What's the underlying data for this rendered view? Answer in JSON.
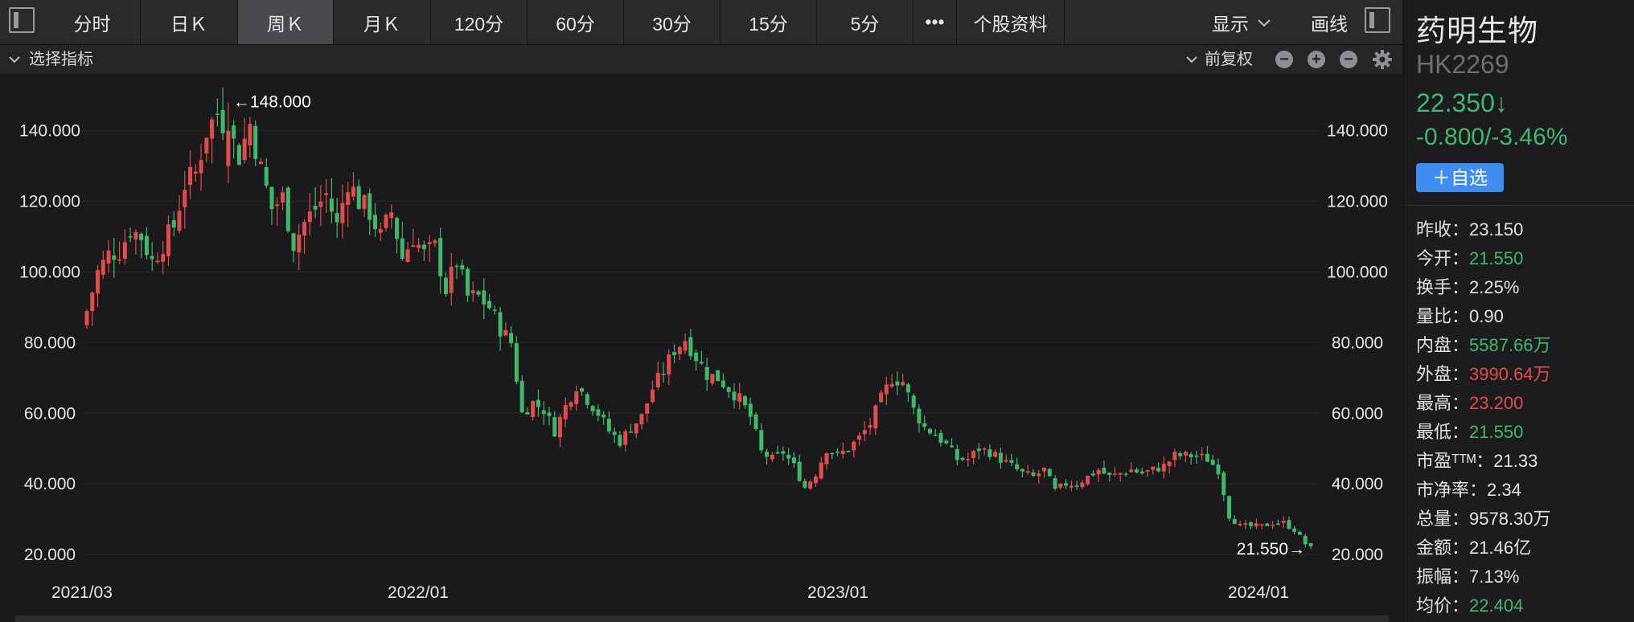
{
  "tabs": [
    {
      "label": "分时",
      "active": false
    },
    {
      "label": "日Ｋ",
      "active": false
    },
    {
      "label": "周Ｋ",
      "active": true
    },
    {
      "label": "月Ｋ",
      "active": false
    },
    {
      "label": "120分",
      "active": false
    },
    {
      "label": "60分",
      "active": false
    },
    {
      "label": "30分",
      "active": false
    },
    {
      "label": "15分",
      "active": false
    },
    {
      "label": "5分",
      "active": false
    },
    {
      "label": "•••",
      "active": false
    },
    {
      "label": "个股资料",
      "active": false
    }
  ],
  "toolbar": {
    "display_label": "显示",
    "draw_label": "画线"
  },
  "subbar": {
    "indicator_label": "选择指标",
    "adjust_label": "前复权",
    "minus_icon": "−",
    "plus_icon": "+"
  },
  "stock": {
    "name": "药明生物",
    "code": "HK2269",
    "price": "22.350↓",
    "change": "-0.800/-3.46%",
    "add_button": "＋自选"
  },
  "stats": [
    {
      "label": "昨收：",
      "value": "23.150",
      "color": "neutral"
    },
    {
      "label": "今开：",
      "value": "21.550",
      "color": "down"
    },
    {
      "label": "换手：",
      "value": "2.25%",
      "color": "neutral"
    },
    {
      "label": "量比：",
      "value": "0.90",
      "color": "neutral"
    },
    {
      "label": "内盘：",
      "value": "5587.66万",
      "color": "down"
    },
    {
      "label": "外盘：",
      "value": "3990.64万",
      "color": "up"
    },
    {
      "label": "最高：",
      "value": "23.200",
      "color": "up"
    },
    {
      "label": "最低：",
      "value": "21.550",
      "color": "down"
    },
    {
      "label": "市盈ᵀᵀᴹ：",
      "value": "21.33",
      "color": "neutral"
    },
    {
      "label": "市净率：",
      "value": "2.34",
      "color": "neutral"
    },
    {
      "label": "总量：",
      "value": "9578.30万",
      "color": "neutral"
    },
    {
      "label": "金额：",
      "value": "21.46亿",
      "color": "neutral"
    },
    {
      "label": "振幅：",
      "value": "7.13%",
      "color": "neutral"
    },
    {
      "label": "均价：",
      "value": "22.404",
      "color": "down"
    }
  ],
  "colors": {
    "up": "#e24b4b",
    "down": "#3fb86a",
    "background": "#1a1a1d",
    "accent": "#3d8ef0"
  },
  "chart_data": {
    "type": "candlestick",
    "period": "weekly",
    "ylim": [
      15,
      152
    ],
    "y_ticks": [
      "20.000",
      "40.000",
      "60.000",
      "80.000",
      "100.000",
      "120.000",
      "140.000"
    ],
    "x_tick_labels": [
      "2021/03",
      "2022/01",
      "2023/01",
      "2024/01"
    ],
    "max_label": "←148.000",
    "min_label": "21.550→",
    "max_value": 148,
    "min_value": 21.55,
    "close_points": [
      [
        0,
        89
      ],
      [
        2,
        100
      ],
      [
        4,
        105
      ],
      [
        6,
        106
      ],
      [
        8,
        112
      ],
      [
        10,
        110
      ],
      [
        12,
        103
      ],
      [
        14,
        108
      ],
      [
        16,
        113
      ],
      [
        18,
        125
      ],
      [
        20,
        128
      ],
      [
        22,
        140
      ],
      [
        24,
        145
      ],
      [
        26,
        140
      ],
      [
        28,
        133
      ],
      [
        30,
        142
      ],
      [
        32,
        129
      ],
      [
        34,
        118
      ],
      [
        36,
        121
      ],
      [
        38,
        108
      ],
      [
        40,
        114
      ],
      [
        42,
        118
      ],
      [
        44,
        122
      ],
      [
        46,
        113
      ],
      [
        48,
        126
      ],
      [
        50,
        120
      ],
      [
        52,
        117
      ],
      [
        54,
        110
      ],
      [
        56,
        117
      ],
      [
        58,
        104
      ],
      [
        60,
        110
      ],
      [
        62,
        105
      ],
      [
        64,
        107
      ],
      [
        66,
        95
      ],
      [
        68,
        103
      ],
      [
        70,
        93
      ],
      [
        72,
        93
      ],
      [
        74,
        90
      ],
      [
        76,
        84
      ],
      [
        78,
        80
      ],
      [
        80,
        60
      ],
      [
        82,
        63
      ],
      [
        84,
        61
      ],
      [
        86,
        55
      ],
      [
        88,
        62
      ],
      [
        90,
        68
      ],
      [
        92,
        64
      ],
      [
        94,
        60
      ],
      [
        96,
        55
      ],
      [
        98,
        52
      ],
      [
        100,
        56
      ],
      [
        102,
        59
      ],
      [
        104,
        67
      ],
      [
        106,
        72
      ],
      [
        108,
        78
      ],
      [
        110,
        81
      ],
      [
        112,
        76
      ],
      [
        114,
        71
      ],
      [
        116,
        70
      ],
      [
        118,
        67
      ],
      [
        120,
        64
      ],
      [
        122,
        59
      ],
      [
        124,
        49
      ],
      [
        126,
        47
      ],
      [
        128,
        49
      ],
      [
        130,
        45
      ],
      [
        132,
        39
      ],
      [
        134,
        43
      ],
      [
        136,
        50
      ],
      [
        138,
        48
      ],
      [
        140,
        50
      ],
      [
        142,
        53
      ],
      [
        144,
        57
      ],
      [
        146,
        64
      ],
      [
        148,
        70
      ],
      [
        150,
        69
      ],
      [
        152,
        61
      ],
      [
        154,
        56
      ],
      [
        156,
        54
      ],
      [
        158,
        51
      ],
      [
        160,
        47
      ],
      [
        162,
        47
      ],
      [
        164,
        50
      ],
      [
        166,
        49
      ],
      [
        168,
        47
      ],
      [
        170,
        45
      ],
      [
        172,
        43
      ],
      [
        174,
        42
      ],
      [
        176,
        44
      ],
      [
        178,
        38
      ],
      [
        180,
        40
      ],
      [
        182,
        40
      ],
      [
        184,
        42
      ],
      [
        186,
        44
      ],
      [
        188,
        42
      ],
      [
        190,
        43
      ],
      [
        192,
        44
      ],
      [
        194,
        43
      ],
      [
        196,
        44
      ],
      [
        198,
        45
      ],
      [
        200,
        48
      ],
      [
        202,
        48
      ],
      [
        204,
        48
      ],
      [
        206,
        47
      ],
      [
        208,
        44
      ],
      [
        210,
        31
      ],
      [
        212,
        28
      ],
      [
        214,
        28
      ],
      [
        216,
        28
      ],
      [
        218,
        29
      ],
      [
        220,
        29
      ],
      [
        222,
        27
      ],
      [
        224,
        23
      ],
      [
        225,
        22.35
      ]
    ]
  }
}
